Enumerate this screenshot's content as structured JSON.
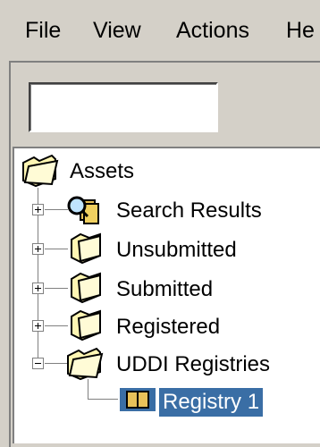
{
  "menubar": {
    "items": [
      {
        "label": "File"
      },
      {
        "label": "View"
      },
      {
        "label": "Actions"
      },
      {
        "label": "He"
      }
    ]
  },
  "search": {
    "value": ""
  },
  "tree": {
    "root": {
      "label": "Assets",
      "icon": "open-folder-icon"
    },
    "children": [
      {
        "label": "Search Results",
        "icon": "search-results-icon",
        "expander": "plus"
      },
      {
        "label": "Unsubmitted",
        "icon": "folder-icon",
        "expander": "plus"
      },
      {
        "label": "Submitted",
        "icon": "folder-icon",
        "expander": "plus"
      },
      {
        "label": "Registered",
        "icon": "folder-icon",
        "expander": "plus"
      },
      {
        "label": "UDDI Registries",
        "icon": "open-folder-icon",
        "expander": "minus",
        "children": [
          {
            "label": "Registry 1",
            "icon": "registry-icon",
            "selected": true
          }
        ]
      }
    ]
  },
  "colors": {
    "selection": "#3a6ea5",
    "folder": "#fff6b3",
    "chrome": "#d4d0c8"
  }
}
